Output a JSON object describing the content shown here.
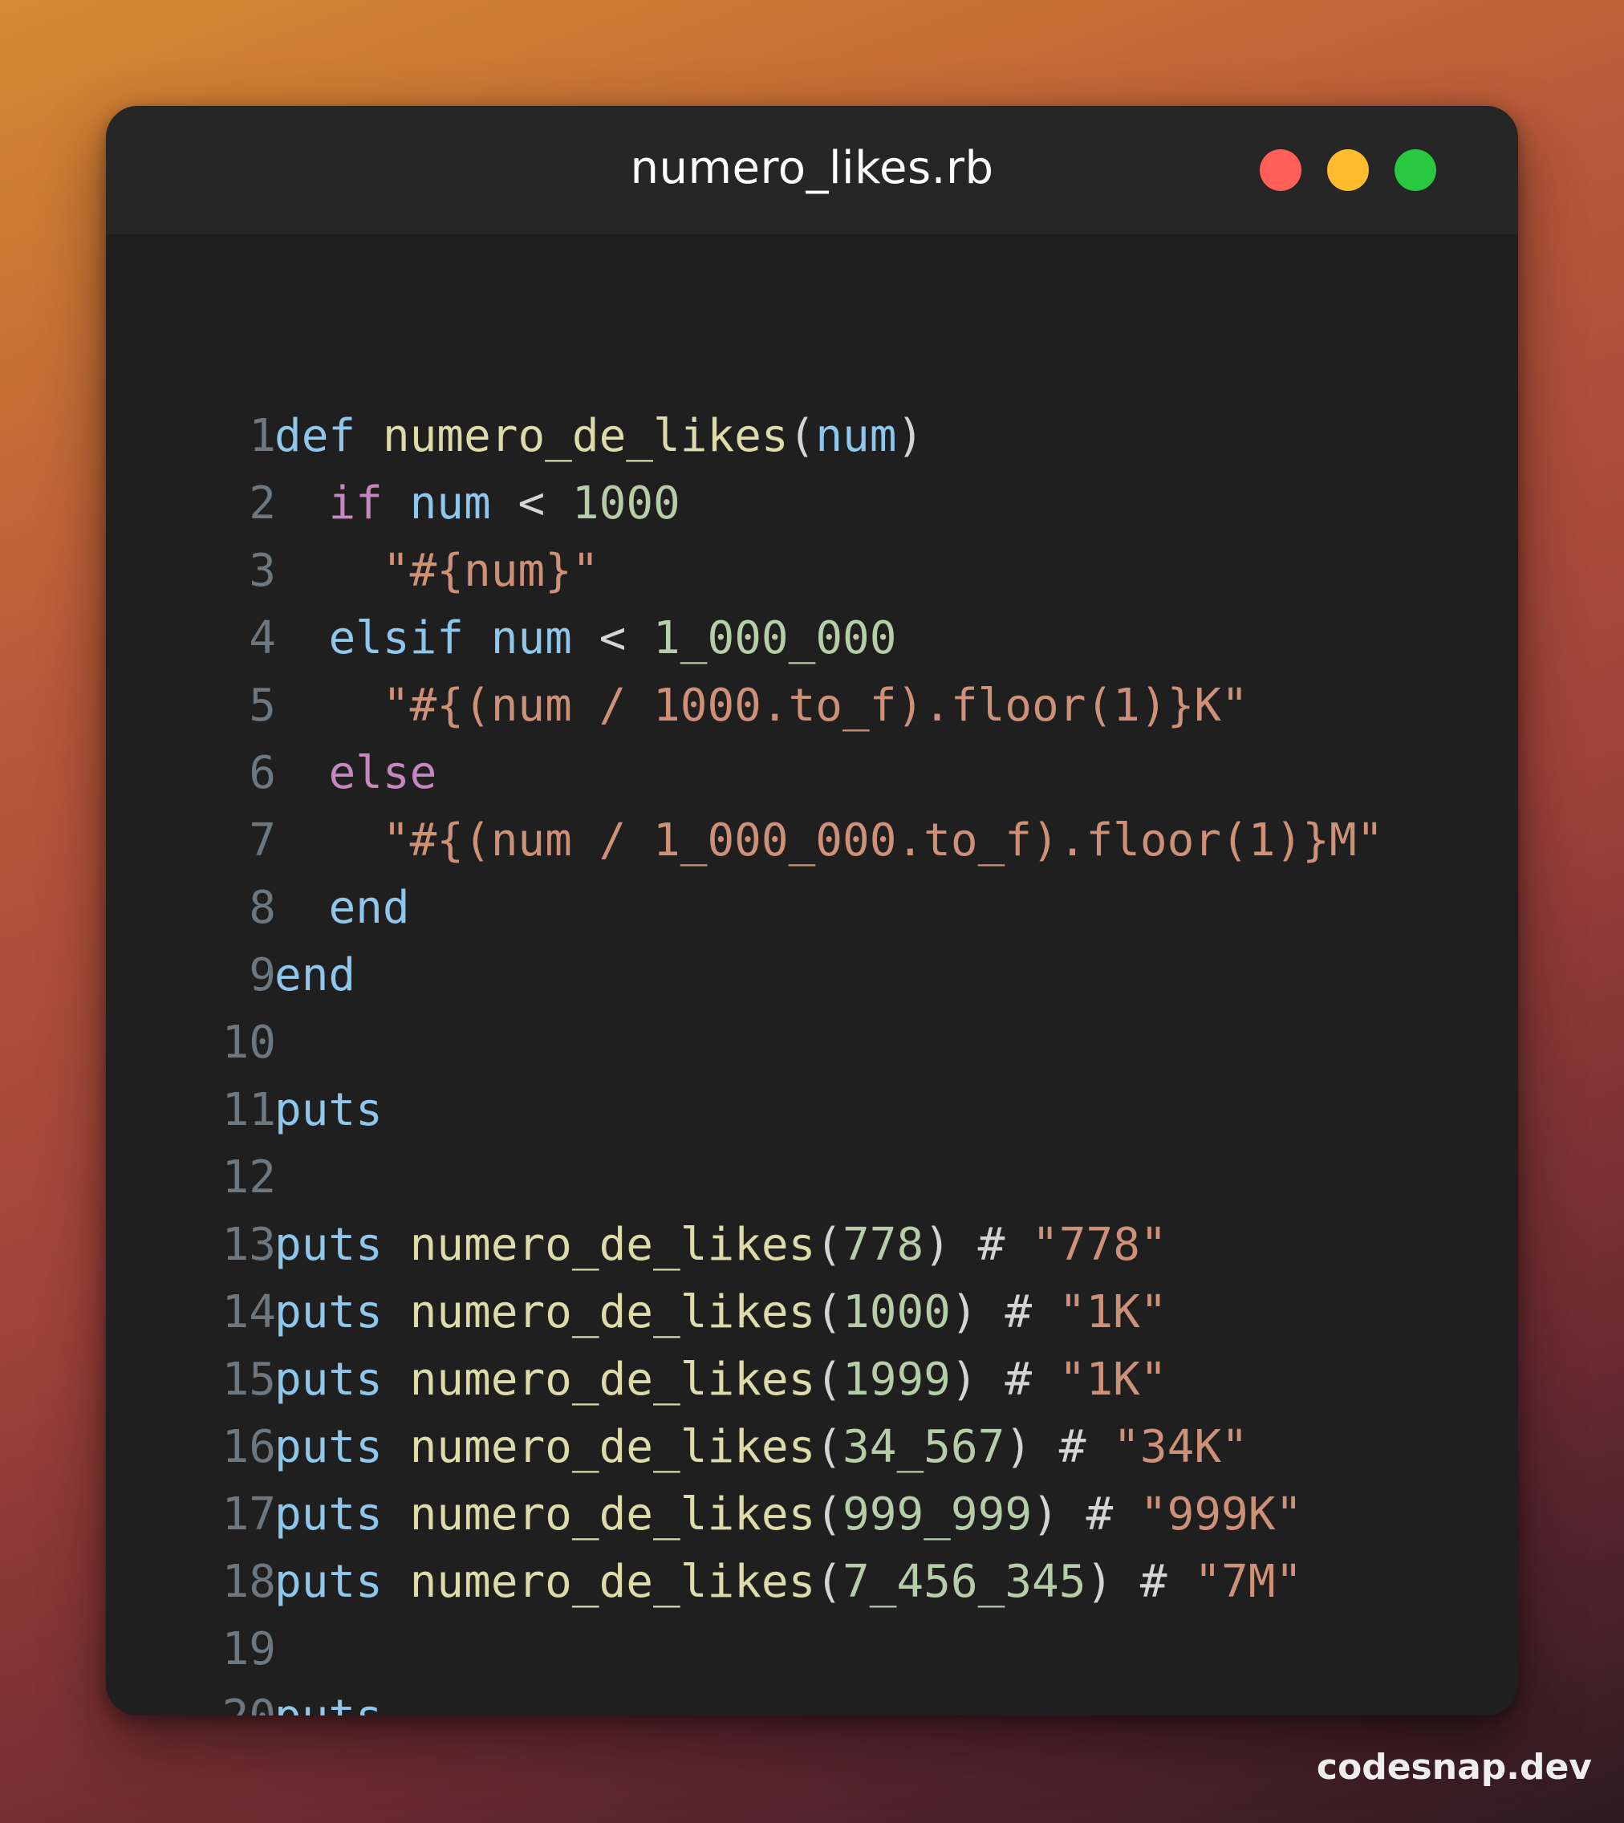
{
  "window": {
    "title": "numero_likes.rb",
    "controls": [
      {
        "name": "close",
        "color": "#ff5f57"
      },
      {
        "name": "minimize",
        "color": "#febc2e"
      },
      {
        "name": "maximize",
        "color": "#28c840"
      }
    ]
  },
  "code": {
    "lines": [
      {
        "n": "1",
        "tokens": [
          [
            "kw",
            "def"
          ],
          [
            "op",
            " "
          ],
          [
            "fn",
            "numero_de_likes"
          ],
          [
            "op",
            "("
          ],
          [
            "kw",
            "num"
          ],
          [
            "op",
            ")"
          ]
        ]
      },
      {
        "n": "2",
        "tokens": [
          [
            "op",
            "  "
          ],
          [
            "ctl",
            "if"
          ],
          [
            "op",
            " "
          ],
          [
            "kw",
            "num"
          ],
          [
            "op",
            " < "
          ],
          [
            "num",
            "1000"
          ]
        ]
      },
      {
        "n": "3",
        "tokens": [
          [
            "op",
            "    "
          ],
          [
            "str",
            "\"#{num}\""
          ]
        ]
      },
      {
        "n": "4",
        "tokens": [
          [
            "op",
            "  "
          ],
          [
            "kw",
            "elsif"
          ],
          [
            "op",
            " "
          ],
          [
            "kw",
            "num"
          ],
          [
            "op",
            " < "
          ],
          [
            "num",
            "1_000_000"
          ]
        ]
      },
      {
        "n": "5",
        "tokens": [
          [
            "op",
            "    "
          ],
          [
            "str",
            "\"#{(num / 1000.to_f).floor(1)}K\""
          ]
        ]
      },
      {
        "n": "6",
        "tokens": [
          [
            "op",
            "  "
          ],
          [
            "ctl",
            "else"
          ]
        ]
      },
      {
        "n": "7",
        "tokens": [
          [
            "op",
            "    "
          ],
          [
            "str",
            "\"#{(num / 1_000_000.to_f).floor(1)}M\""
          ]
        ]
      },
      {
        "n": "8",
        "tokens": [
          [
            "op",
            "  "
          ],
          [
            "kw",
            "end"
          ]
        ]
      },
      {
        "n": "9",
        "tokens": [
          [
            "kw",
            "end"
          ]
        ]
      },
      {
        "n": "10",
        "tokens": []
      },
      {
        "n": "11",
        "tokens": [
          [
            "kw",
            "puts"
          ]
        ]
      },
      {
        "n": "12",
        "tokens": []
      },
      {
        "n": "13",
        "tokens": [
          [
            "kw",
            "puts"
          ],
          [
            "op",
            " "
          ],
          [
            "fn",
            "numero_de_likes"
          ],
          [
            "op",
            "("
          ],
          [
            "num",
            "778"
          ],
          [
            "op",
            ") # "
          ],
          [
            "str",
            "\"778\""
          ]
        ]
      },
      {
        "n": "14",
        "tokens": [
          [
            "kw",
            "puts"
          ],
          [
            "op",
            " "
          ],
          [
            "fn",
            "numero_de_likes"
          ],
          [
            "op",
            "("
          ],
          [
            "num",
            "1000"
          ],
          [
            "op",
            ") # "
          ],
          [
            "str",
            "\"1K\""
          ]
        ]
      },
      {
        "n": "15",
        "tokens": [
          [
            "kw",
            "puts"
          ],
          [
            "op",
            " "
          ],
          [
            "fn",
            "numero_de_likes"
          ],
          [
            "op",
            "("
          ],
          [
            "num",
            "1999"
          ],
          [
            "op",
            ") # "
          ],
          [
            "str",
            "\"1K\""
          ]
        ]
      },
      {
        "n": "16",
        "tokens": [
          [
            "kw",
            "puts"
          ],
          [
            "op",
            " "
          ],
          [
            "fn",
            "numero_de_likes"
          ],
          [
            "op",
            "("
          ],
          [
            "num",
            "34_567"
          ],
          [
            "op",
            ") # "
          ],
          [
            "str",
            "\"34K\""
          ]
        ]
      },
      {
        "n": "17",
        "tokens": [
          [
            "kw",
            "puts"
          ],
          [
            "op",
            " "
          ],
          [
            "fn",
            "numero_de_likes"
          ],
          [
            "op",
            "("
          ],
          [
            "num",
            "999_999"
          ],
          [
            "op",
            ") # "
          ],
          [
            "str",
            "\"999K\""
          ]
        ]
      },
      {
        "n": "18",
        "tokens": [
          [
            "kw",
            "puts"
          ],
          [
            "op",
            " "
          ],
          [
            "fn",
            "numero_de_likes"
          ],
          [
            "op",
            "("
          ],
          [
            "num",
            "7_456_345"
          ],
          [
            "op",
            ") # "
          ],
          [
            "str",
            "\"7M\""
          ]
        ]
      },
      {
        "n": "19",
        "tokens": []
      },
      {
        "n": "20",
        "tokens": [
          [
            "kw",
            "puts"
          ]
        ]
      }
    ]
  },
  "watermark": "codesnap.dev"
}
